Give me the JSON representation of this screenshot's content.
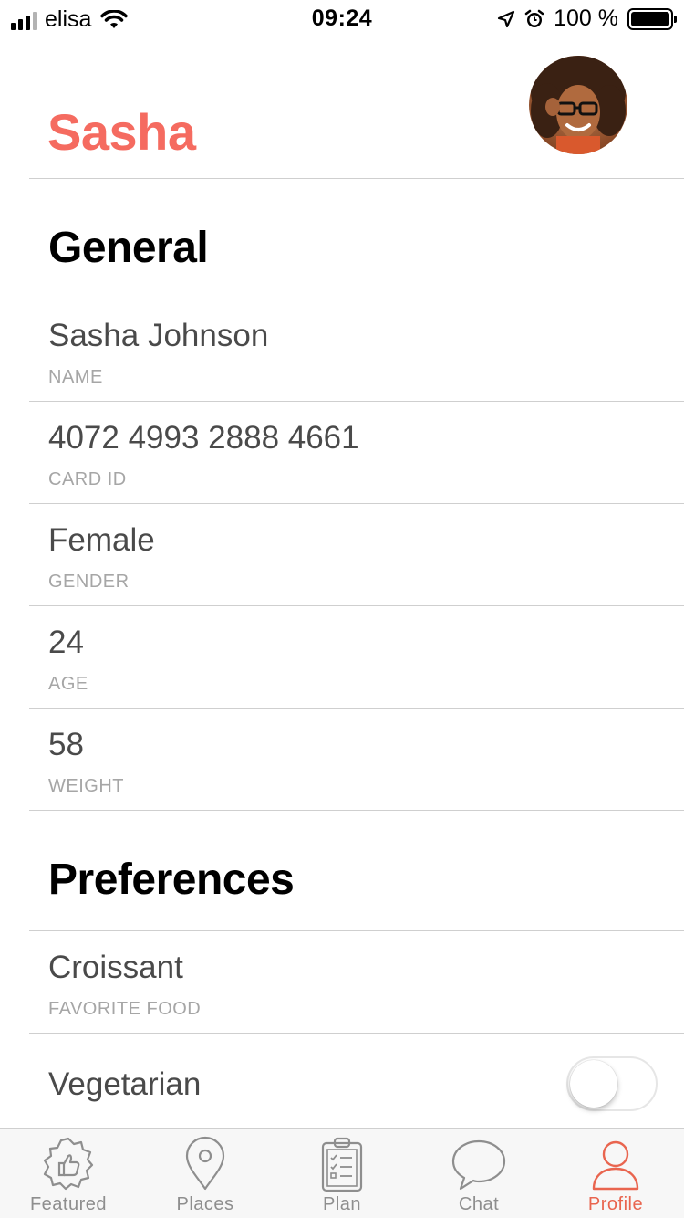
{
  "status_bar": {
    "carrier": "elisa",
    "time": "09:24",
    "battery_text": "100 %"
  },
  "header": {
    "title": "Sasha",
    "accent_color": "#f56b60"
  },
  "sections": {
    "general": {
      "title": "General",
      "rows": [
        {
          "value": "Sasha Johnson",
          "label": "NAME"
        },
        {
          "value": "4072 4993 2888 4661",
          "label": "CARD ID"
        },
        {
          "value": "Female",
          "label": "GENDER"
        },
        {
          "value": "24",
          "label": "AGE"
        },
        {
          "value": "58",
          "label": "WEIGHT"
        }
      ]
    },
    "preferences": {
      "title": "Preferences",
      "rows": [
        {
          "value": "Croissant",
          "label": "FAVORITE FOOD"
        }
      ],
      "toggle_row": {
        "label": "Vegetarian",
        "state": "off"
      }
    }
  },
  "tab_bar": {
    "active_color": "#e9654f",
    "tabs": [
      {
        "label": "Featured",
        "icon": "badge-thumbs-up-icon",
        "active": false
      },
      {
        "label": "Places",
        "icon": "map-pin-icon",
        "active": false
      },
      {
        "label": "Plan",
        "icon": "clipboard-checklist-icon",
        "active": false
      },
      {
        "label": "Chat",
        "icon": "speech-bubble-icon",
        "active": false
      },
      {
        "label": "Profile",
        "icon": "person-icon",
        "active": true
      }
    ]
  }
}
